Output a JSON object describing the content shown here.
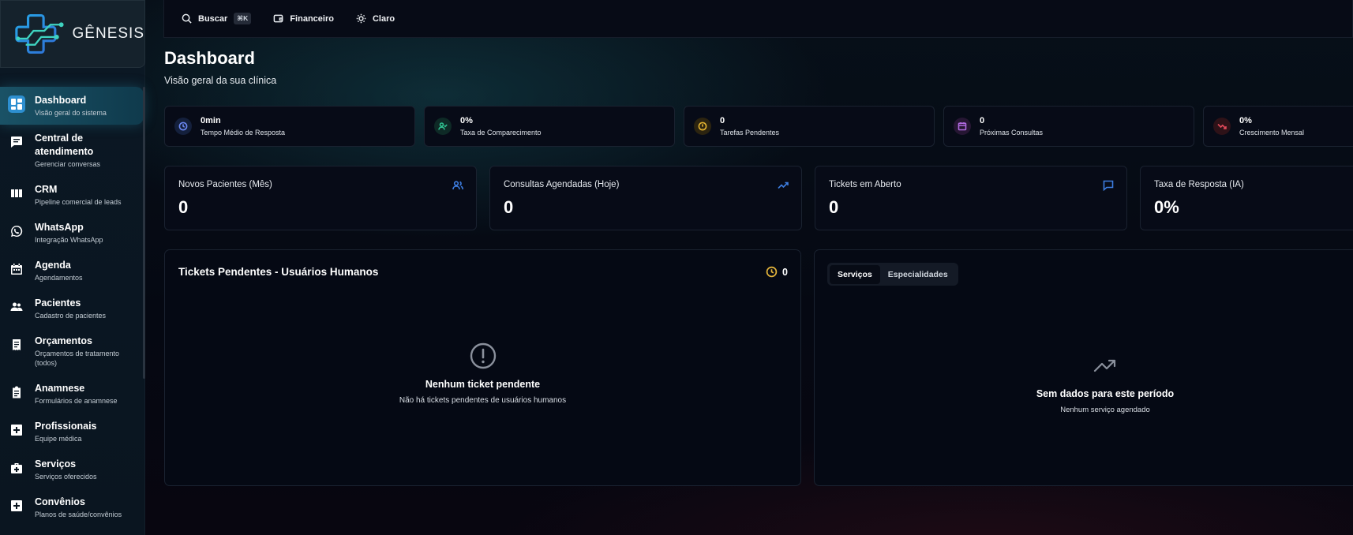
{
  "brand": {
    "name": "GÊNESIS"
  },
  "sidebar": {
    "items": [
      {
        "label": "Dashboard",
        "sub": "Visão geral do sistema",
        "icon": "dashboard-icon",
        "active": true
      },
      {
        "label": "Central de atendimento",
        "sub": "Gerenciar conversas",
        "icon": "chat-icon"
      },
      {
        "label": "CRM",
        "sub": "Pipeline comercial de leads",
        "icon": "kanban-icon"
      },
      {
        "label": "WhatsApp",
        "sub": "Integração WhatsApp",
        "icon": "whatsapp-icon"
      },
      {
        "label": "Agenda",
        "sub": "Agendamentos",
        "icon": "calendar-icon"
      },
      {
        "label": "Pacientes",
        "sub": "Cadastro de pacientes",
        "icon": "people-icon"
      },
      {
        "label": "Orçamentos",
        "sub": "Orçamentos de tratamento (todos)",
        "icon": "receipt-icon"
      },
      {
        "label": "Anamnese",
        "sub": "Formulários de anamnese",
        "icon": "clipboard-icon"
      },
      {
        "label": "Profissionais",
        "sub": "Equipe médica",
        "icon": "medical-plus-icon"
      },
      {
        "label": "Serviços",
        "sub": "Serviços oferecidos",
        "icon": "medical-bag-icon"
      },
      {
        "label": "Convênios",
        "sub": "Planos de saúde/convênios",
        "icon": "health-plan-icon"
      }
    ]
  },
  "topbar": {
    "search_label": "Buscar",
    "search_shortcut": "⌘K",
    "finance_label": "Financeiro",
    "theme_label": "Claro"
  },
  "page": {
    "title": "Dashboard",
    "subtitle": "Visão geral da sua clínica"
  },
  "mini_stats": [
    {
      "value": "0min",
      "label": "Tempo Médio de Resposta",
      "icon": "clock-icon",
      "color": "#6a86f0",
      "bg": "#14203c"
    },
    {
      "value": "0%",
      "label": "Taxa de Comparecimento",
      "icon": "user-check-icon",
      "color": "#2fbf8f",
      "bg": "#0e2a26"
    },
    {
      "value": "0",
      "label": "Tarefas Pendentes",
      "icon": "alert-circle-icon",
      "color": "#e3b330",
      "bg": "#2c2410"
    },
    {
      "value": "0",
      "label": "Próximas Consultas",
      "icon": "calendar-icon",
      "color": "#b06ae0",
      "bg": "#261633"
    },
    {
      "value": "0%",
      "label": "Crescimento Mensal",
      "icon": "trending-down-icon",
      "color": "#e04a5a",
      "bg": "#2e1218"
    }
  ],
  "big_stats": [
    {
      "label": "Novos Pacientes (Mês)",
      "value": "0",
      "icon": "users-icon"
    },
    {
      "label": "Consultas Agendadas (Hoje)",
      "value": "0",
      "icon": "trending-up-icon"
    },
    {
      "label": "Tickets em Aberto",
      "value": "0",
      "icon": "message-icon"
    },
    {
      "label": "Taxa de Resposta (IA)",
      "value": "0%",
      "icon": ""
    }
  ],
  "tickets_panel": {
    "title": "Tickets Pendentes - Usuários Humanos",
    "count": "0",
    "empty_title": "Nenhum ticket pendente",
    "empty_sub": "Não há tickets pendentes de usuários humanos"
  },
  "services_panel": {
    "tabs": [
      "Serviços",
      "Especialidades"
    ],
    "active_tab": "Serviços",
    "empty_title": "Sem dados para este período",
    "empty_sub": "Nenhum serviço agendado"
  }
}
